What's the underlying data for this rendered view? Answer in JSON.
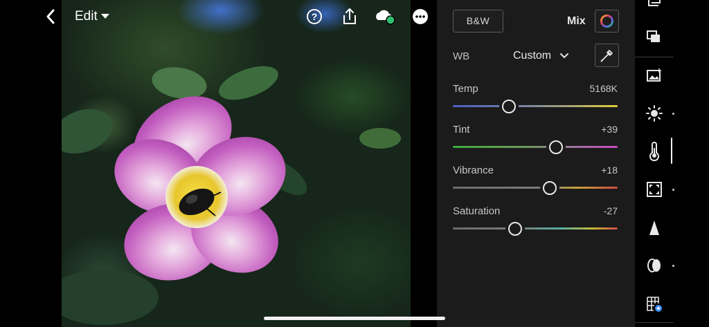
{
  "topbar": {
    "edit_label": "Edit",
    "icons": [
      "back-chevron-icon",
      "help-icon",
      "share-icon",
      "cloud-sync-icon",
      "more-icon"
    ],
    "sync_status_color": "#2fbf71"
  },
  "panel": {
    "bw_label": "B&W",
    "mix_label": "Mix",
    "wb_label": "WB",
    "wb_value": "Custom",
    "sliders": [
      {
        "label": "Temp",
        "value": "5168K",
        "position": 0.34
      },
      {
        "label": "Tint",
        "value": "+39",
        "position": 0.625
      },
      {
        "label": "Vibrance",
        "value": "+18",
        "position": 0.59
      },
      {
        "label": "Saturation",
        "value": "-27",
        "position": 0.38
      }
    ]
  },
  "tools": {
    "items": [
      "crop-rotate-icon",
      "versions-icon",
      "auto-enhance-icon",
      "light-icon",
      "color-icon",
      "effects-icon",
      "detail-icon",
      "optics-icon",
      "geometry-icon"
    ],
    "active": "color-icon"
  },
  "colors": {
    "panel_bg": "#1b1b1b",
    "accent_white": "#e8e8e8"
  }
}
